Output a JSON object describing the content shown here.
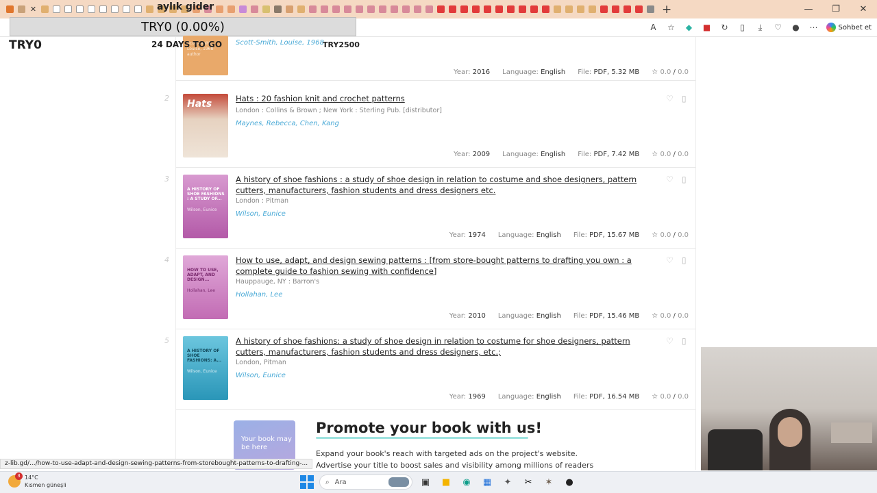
{
  "budget": {
    "title": "aylık gider",
    "progress_text": "TRY0 (0.00%)",
    "saved": "TRY0",
    "days_to_go": "24 DAYS TO GO",
    "goal": "TRY2500"
  },
  "browser": {
    "chat_label": "Sohbet et"
  },
  "books": [
    {
      "num": "",
      "title": "",
      "publisher": "",
      "author": "Scott-Smith, Louise, 1968-",
      "year": "2016",
      "language": "English",
      "file": "PDF, 5.32 MB",
      "rating": "0.0",
      "rating_max": "0.0",
      "cover_color": "#e9a96a",
      "cover_title": "",
      "cover_author": "Scott-Smith, Louise, 1968- author"
    },
    {
      "num": "2",
      "title": "Hats : 20 fashion knit and crochet patterns",
      "publisher": "London : Collins & Brown ; New York : Sterling Pub. [distributor]",
      "author": "Maynes, Rebecca, Chen, Kang",
      "year": "2009",
      "language": "English",
      "file": "PDF, 7.42 MB",
      "rating": "0.0",
      "rating_max": "0.0",
      "cover_color": "#c44a3a",
      "cover_title": "Hats",
      "cover_author": ""
    },
    {
      "num": "3",
      "title": "A history of shoe fashions : a study of shoe design in relation to costume and shoe designers, pattern cutters, manufacturers, fashion students and dress designers etc.",
      "publisher": "London : Pitman",
      "author": "Wilson, Eunice",
      "year": "1974",
      "language": "English",
      "file": "PDF, 15.67 MB",
      "rating": "0.0",
      "rating_max": "0.0",
      "cover_color": "#c76fb8",
      "cover_title": "A HISTORY OF SHOE FASHIONS : A STUDY OF...",
      "cover_author": "Wilson, Eunice"
    },
    {
      "num": "4",
      "title": "How to use, adapt, and design sewing patterns : [from store-bought patterns to drafting you own : a complete guide to fashion sewing with confidence]",
      "publisher": "Hauppauge, NY : Barron's",
      "author": "Hollahan, Lee",
      "year": "2010",
      "language": "English",
      "file": "PDF, 15.46 MB",
      "rating": "0.0",
      "rating_max": "0.0",
      "cover_color": "#c77bbd",
      "cover_title": "HOW TO USE, ADAPT, AND DESIGN...",
      "cover_author": "Hollahan, Lee"
    },
    {
      "num": "5",
      "title": "A history of shoe fashions: a study of shoe design in relation to costume for shoe designers, pattern cutters, manufacturers, fashion students and dress designers, etc.;",
      "publisher": "London, Pitman",
      "author": "Wilson, Eunice",
      "year": "1969",
      "language": "English",
      "file": "PDF, 16.54 MB",
      "rating": "0.0",
      "rating_max": "0.0",
      "cover_color": "#3aa6c4",
      "cover_title": "A HISTORY OF SHOE FASHIONS: A...",
      "cover_author": "Wilson, Eunice"
    }
  ],
  "labels": {
    "year": "Year:",
    "language": "Language:",
    "file": "File:",
    "rating_sep": "/"
  },
  "promo": {
    "image_text": "Your book may be here",
    "heading": "Promote your book with us!",
    "line1": "Expand your book's reach with targeted ads on the project's website.",
    "line2": "Advertise your title to boost sales and visibility among millions of readers"
  },
  "status_url": "z-lib.gd/.../how-to-use-adapt-and-design-sewing-patterns-from-storebought-patterns-to-drafting-...",
  "taskbar": {
    "weather_temp": "14°C",
    "weather_desc": "Kısmen güneşli",
    "notif_count": "3",
    "search_placeholder": "Ara"
  }
}
